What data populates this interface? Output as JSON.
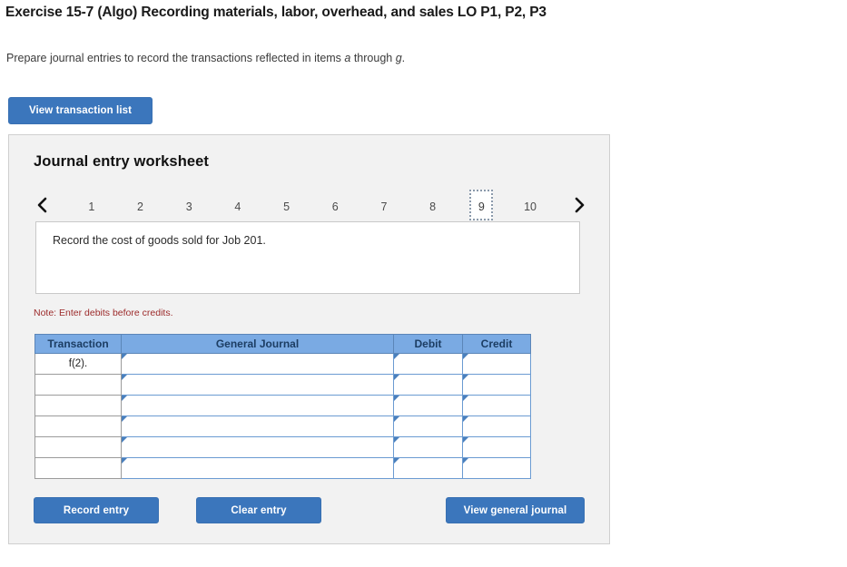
{
  "exercise": {
    "title": "Exercise 15-7 (Algo) Recording materials, labor, overhead, and sales LO P1, P2, P3",
    "prompt_before": "Prepare journal entries to record the transactions reflected in items ",
    "prompt_italic_1": "a",
    "prompt_middle": " through ",
    "prompt_italic_2": "g",
    "prompt_after": "."
  },
  "buttons": {
    "view_transaction_list": "View transaction list",
    "record_entry": "Record entry",
    "clear_entry": "Clear entry",
    "view_general_journal": "View general journal"
  },
  "worksheet": {
    "title": "Journal entry worksheet",
    "prev_arrow_icon": "chevron-left-icon",
    "next_arrow_icon": "chevron-right-icon",
    "pages": [
      "1",
      "2",
      "3",
      "4",
      "5",
      "6",
      "7",
      "8",
      "9",
      "10"
    ],
    "active_page": "9",
    "prompt_text": "Record the cost of goods sold for Job 201.",
    "note": "Note: Enter debits before credits."
  },
  "journal_table": {
    "headers": [
      "Transaction",
      "General Journal",
      "Debit",
      "Credit"
    ],
    "rows": [
      {
        "transaction": "f(2).",
        "general_journal": "",
        "debit": "",
        "credit": ""
      },
      {
        "transaction": "",
        "general_journal": "",
        "debit": "",
        "credit": ""
      },
      {
        "transaction": "",
        "general_journal": "",
        "debit": "",
        "credit": ""
      },
      {
        "transaction": "",
        "general_journal": "",
        "debit": "",
        "credit": ""
      },
      {
        "transaction": "",
        "general_journal": "",
        "debit": "",
        "credit": ""
      },
      {
        "transaction": "",
        "general_journal": "",
        "debit": "",
        "credit": ""
      }
    ]
  },
  "colors": {
    "button_blue": "#3b76bc",
    "table_header_blue": "#7aaae3",
    "panel_gray": "#f2f2f2",
    "note_red": "#9c2b2b",
    "input_border_blue": "#6b9bd2"
  }
}
